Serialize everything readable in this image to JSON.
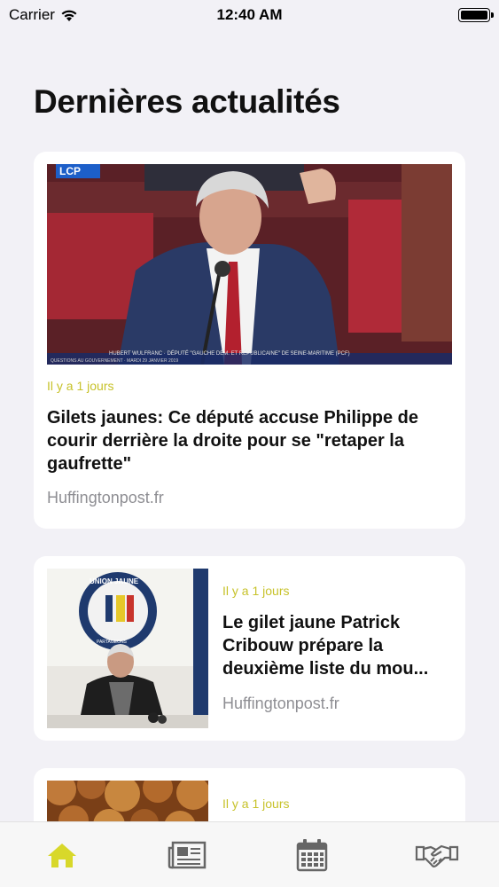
{
  "status": {
    "carrier": "Carrier",
    "time": "12:40 AM"
  },
  "page": {
    "title": "Dernières actualités"
  },
  "articles": [
    {
      "time": "Il y a 1 jours",
      "headline": "Gilets jaunes: Ce député accuse Philippe de courir derrière la droite pour se \"retaper la gaufrette\"",
      "source": "Huffingtonpost.fr",
      "image_overlay": {
        "channel": "LCP",
        "caption": "HUBERT WULFRANC · DÉPUTÉ \"GAUCHE DÉM. ET RÉPUBLICAINE\" DE SEINE-MARITIME (PCF)",
        "subcaption": "QUESTIONS AU GOUVERNEMENT · MARDI 29 JANVIER 2019"
      }
    },
    {
      "time": "Il y a 1 jours",
      "headline_lines": [
        "Le gilet jaune Patrick",
        "Cribouw prépare la",
        "deuxième liste du mou..."
      ],
      "source": "Huffingtonpost.fr",
      "image_overlay": {
        "logo_top": "UNION JAUNE",
        "logo_bottom": "PARTAGEONS"
      }
    },
    {
      "time": "Il y a 1 jours"
    }
  ],
  "tabs": [
    {
      "icon": "home-icon",
      "active": true
    },
    {
      "icon": "newspaper-icon",
      "active": false
    },
    {
      "icon": "calendar-icon",
      "active": false
    },
    {
      "icon": "handshake-icon",
      "active": false
    }
  ],
  "colors": {
    "accent": "#d8d82a",
    "time_text": "#c7c22a",
    "source_text": "#8e8e93",
    "background": "#f2f1f6"
  }
}
